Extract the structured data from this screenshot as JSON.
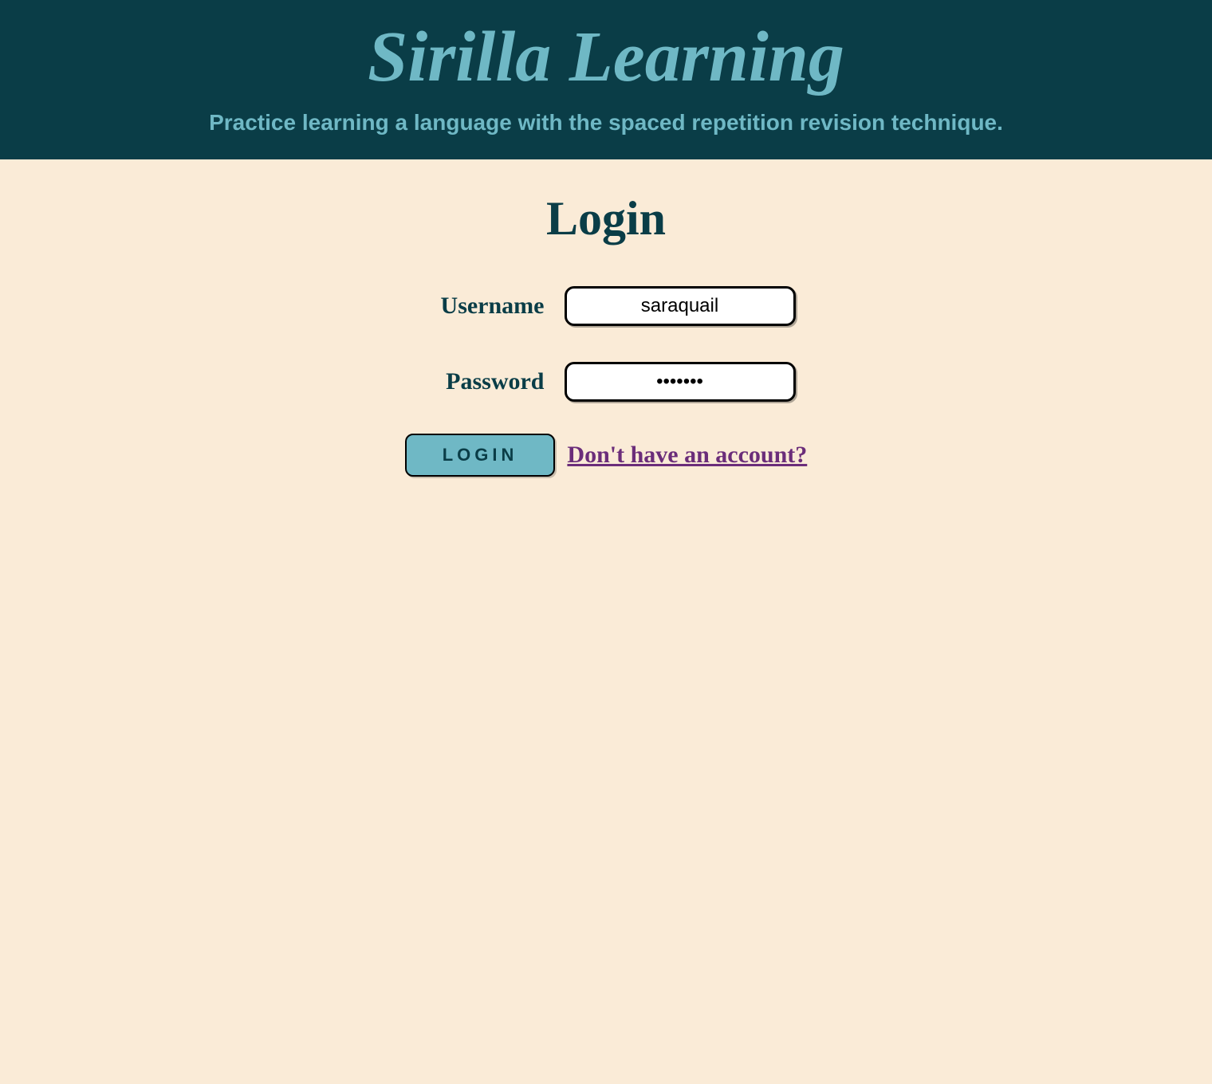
{
  "header": {
    "title": "Sirilla Learning",
    "tagline": "Practice learning a language with the spaced repetition revision technique."
  },
  "main": {
    "heading": "Login",
    "username_label": "Username",
    "username_value": "saraquail",
    "password_label": "Password",
    "password_value": "•••••••",
    "login_button": "LOGIN",
    "signup_link": "Don't have an account?"
  }
}
